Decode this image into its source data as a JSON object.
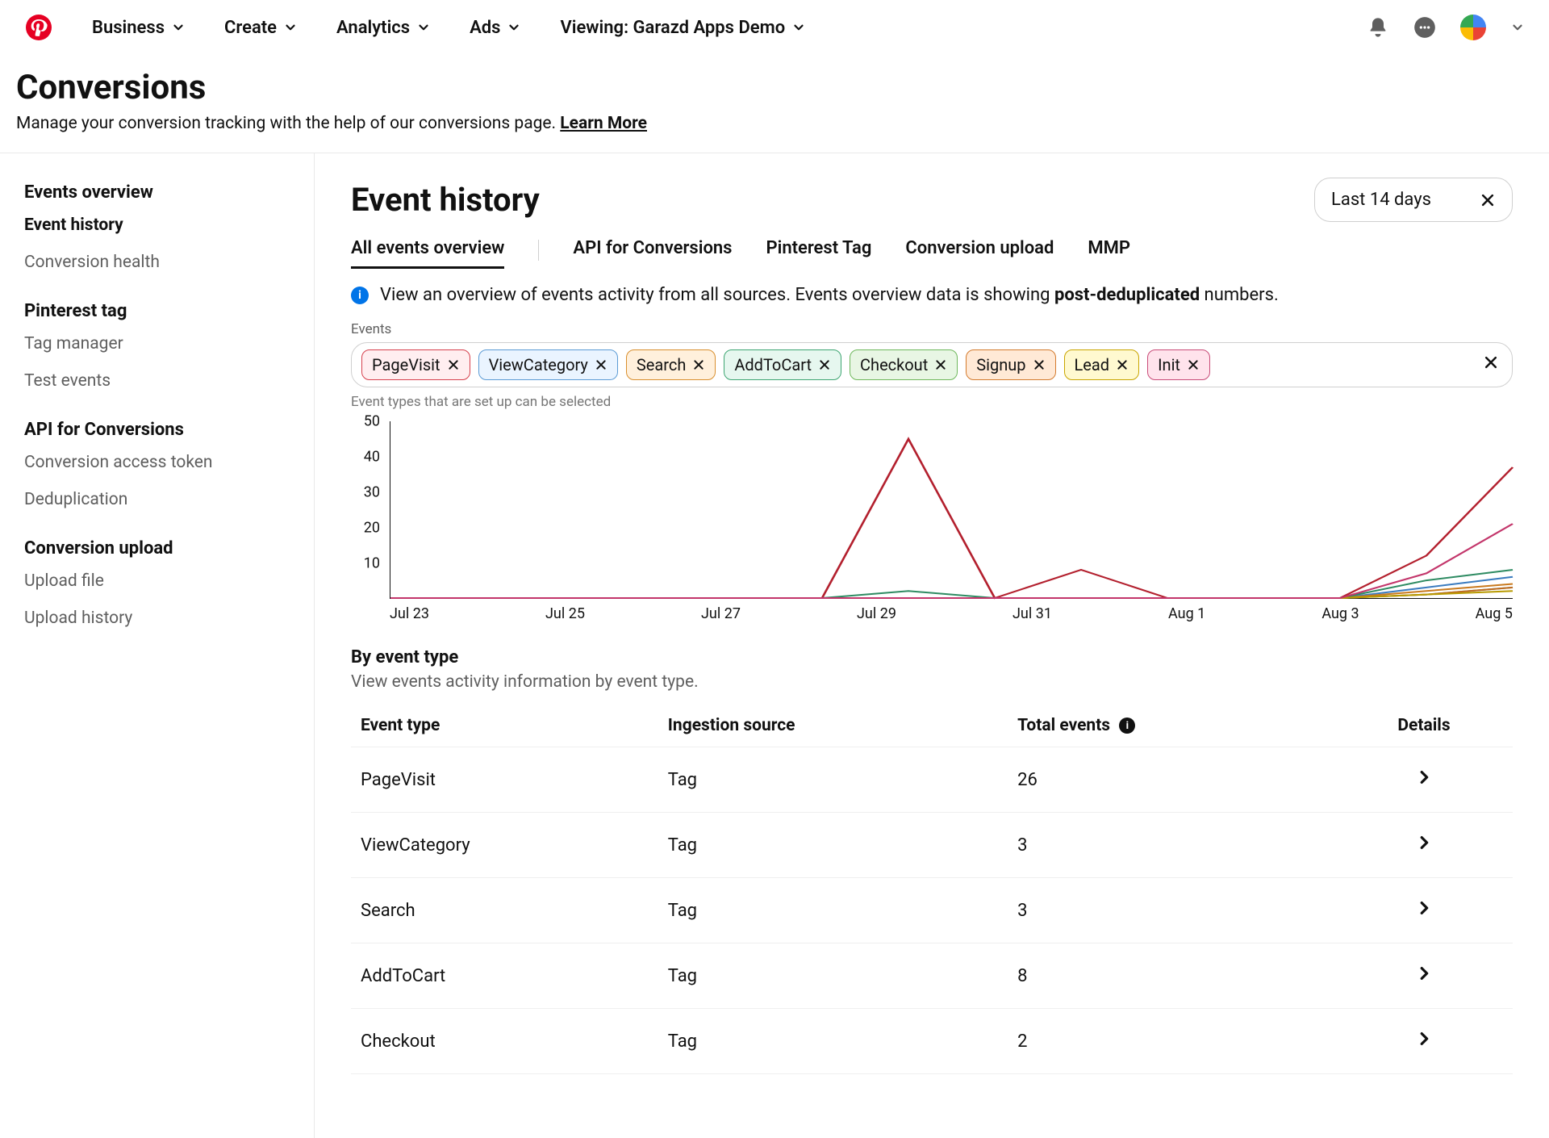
{
  "nav": {
    "items": [
      "Business",
      "Create",
      "Analytics",
      "Ads"
    ],
    "viewing_prefix": "Viewing: ",
    "viewing_account": "Garazd Apps Demo"
  },
  "page": {
    "title": "Conversions",
    "subtitle": "Manage your conversion tracking with the help of our conversions page. ",
    "learn_more": "Learn More"
  },
  "sidebar": {
    "groups": [
      {
        "title": "Events overview",
        "items": [
          {
            "label": "Event history",
            "active": true
          },
          {
            "label": "Conversion health",
            "active": false
          }
        ]
      },
      {
        "title": "Pinterest tag",
        "items": [
          {
            "label": "Tag manager",
            "active": false
          },
          {
            "label": "Test events",
            "active": false
          }
        ]
      },
      {
        "title": "API for Conversions",
        "items": [
          {
            "label": "Conversion access token",
            "active": false
          },
          {
            "label": "Deduplication",
            "active": false
          }
        ]
      },
      {
        "title": "Conversion upload",
        "items": [
          {
            "label": "Upload file",
            "active": false
          },
          {
            "label": "Upload history",
            "active": false
          }
        ]
      }
    ]
  },
  "main": {
    "title": "Event history",
    "date_range": "Last 14 days",
    "tabs": [
      "All events overview",
      "API for Conversions",
      "Pinterest Tag",
      "Conversion upload",
      "MMP"
    ],
    "active_tab": 0,
    "info_text_pre": "View an overview of events activity from all sources. Events overview data is showing ",
    "info_text_bold": "post-deduplicated",
    "info_text_post": " numbers.",
    "events_label": "Events",
    "chips": [
      {
        "label": "PageVisit",
        "bg": "#ffeef0",
        "border": "#d6404d"
      },
      {
        "label": "ViewCategory",
        "bg": "#eaf4ff",
        "border": "#5b9bd5"
      },
      {
        "label": "Search",
        "bg": "#fff0dc",
        "border": "#d98f2e"
      },
      {
        "label": "AddToCart",
        "bg": "#e6f7ef",
        "border": "#3fa673"
      },
      {
        "label": "Checkout",
        "bg": "#e8f6e4",
        "border": "#6fb85c"
      },
      {
        "label": "Signup",
        "bg": "#ffe9d6",
        "border": "#d47b2e"
      },
      {
        "label": "Lead",
        "bg": "#fff9d0",
        "border": "#c9a500"
      },
      {
        "label": "Init",
        "bg": "#ffe3ec",
        "border": "#c94b78"
      }
    ],
    "hint": "Event types that are set up can be selected",
    "by_event": {
      "title": "By event type",
      "subtitle": "View events activity information by event type.",
      "cols": [
        "Event type",
        "Ingestion source",
        "Total events",
        "Details"
      ],
      "rows": [
        {
          "type": "PageVisit",
          "src": "Tag",
          "total": "26"
        },
        {
          "type": "ViewCategory",
          "src": "Tag",
          "total": "3"
        },
        {
          "type": "Search",
          "src": "Tag",
          "total": "3"
        },
        {
          "type": "AddToCart",
          "src": "Tag",
          "total": "8"
        },
        {
          "type": "Checkout",
          "src": "Tag",
          "total": "2"
        }
      ]
    }
  },
  "chart_data": {
    "type": "line",
    "xlabel": "",
    "ylabel": "",
    "ylim": [
      0,
      50
    ],
    "y_ticks": [
      50,
      40,
      30,
      20,
      10
    ],
    "categories": [
      "Jul 23",
      "Jul 25",
      "Jul 27",
      "Jul 29",
      "Jul 31",
      "Aug 1",
      "Aug 3",
      "Aug 5"
    ],
    "x_index": [
      0,
      1,
      2,
      3,
      4,
      5,
      6,
      7,
      8,
      9,
      10,
      11,
      12,
      13
    ],
    "series": [
      {
        "name": "PageVisit",
        "color": "#b3202e",
        "values": [
          0,
          0,
          0,
          0,
          0,
          0,
          45,
          0,
          8,
          0,
          0,
          0,
          12,
          37
        ]
      },
      {
        "name": "ViewCategory",
        "color": "#3a7bbf",
        "values": [
          0,
          0,
          0,
          0,
          0,
          0,
          0,
          0,
          0,
          0,
          0,
          0,
          3,
          6
        ]
      },
      {
        "name": "Search",
        "color": "#c97a1e",
        "values": [
          0,
          0,
          0,
          0,
          0,
          0,
          0,
          0,
          0,
          0,
          0,
          0,
          2,
          4
        ]
      },
      {
        "name": "AddToCart",
        "color": "#2e8b62",
        "values": [
          0,
          0,
          0,
          0,
          0,
          0,
          2,
          0,
          0,
          0,
          0,
          0,
          5,
          8
        ]
      },
      {
        "name": "Checkout",
        "color": "#5aa04a",
        "values": [
          0,
          0,
          0,
          0,
          0,
          0,
          0,
          0,
          0,
          0,
          0,
          0,
          1,
          3
        ]
      },
      {
        "name": "Signup",
        "color": "#c06a22",
        "values": [
          0,
          0,
          0,
          0,
          0,
          0,
          0,
          0,
          0,
          0,
          0,
          0,
          1,
          3
        ]
      },
      {
        "name": "Lead",
        "color": "#b89a00",
        "values": [
          0,
          0,
          0,
          0,
          0,
          0,
          0,
          0,
          0,
          0,
          0,
          0,
          1,
          2
        ]
      },
      {
        "name": "Init",
        "color": "#c3366b",
        "values": [
          0,
          0,
          0,
          0,
          0,
          0,
          0,
          0,
          0,
          0,
          0,
          0,
          7,
          21
        ]
      }
    ]
  }
}
